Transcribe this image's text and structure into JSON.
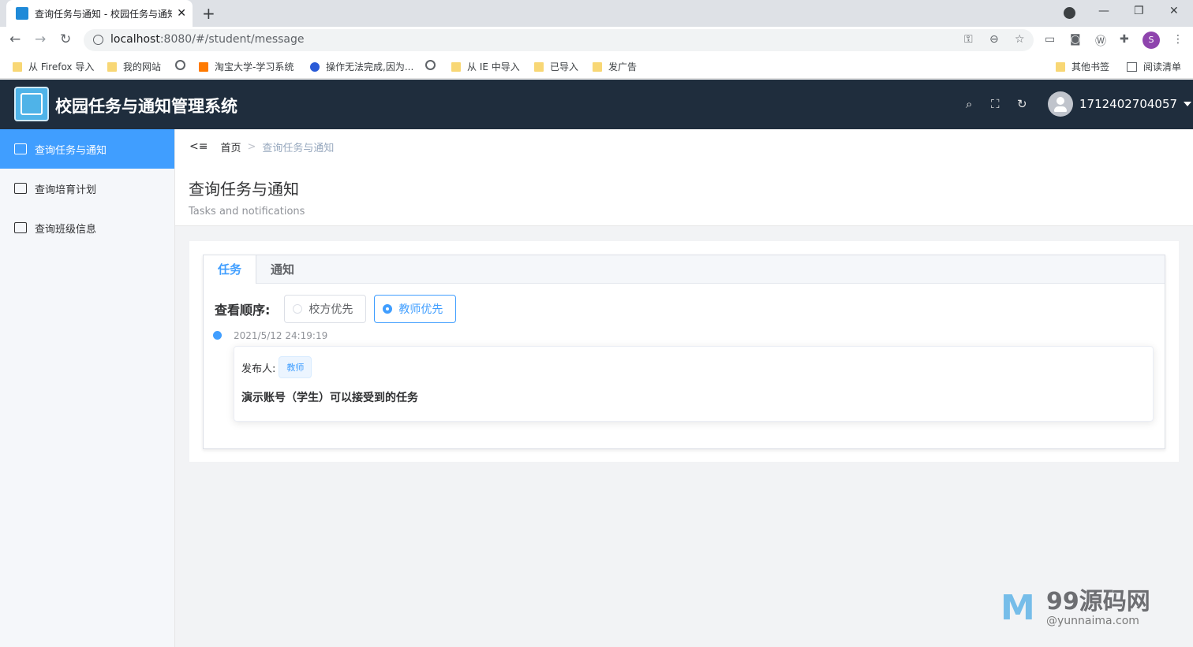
{
  "browser": {
    "tab_title": "查询任务与通知 - 校园任务与通知",
    "url_host": "localhost",
    "url_path": ":8080/#/student/message",
    "profile_initial": "S",
    "bookmarks": [
      "从 Firefox 导入",
      "我的网站",
      "淘宝大学-学习系统",
      "操作无法完成,因为...",
      "从 IE 中导入",
      "已导入",
      "发广告",
      "其他书签",
      "阅读清单"
    ]
  },
  "header": {
    "title": "校园任务与通知管理系统",
    "username": "1712402704057"
  },
  "sidebar": {
    "items": [
      {
        "label": "查询任务与通知",
        "active": true
      },
      {
        "label": "查询培育计划",
        "active": false
      },
      {
        "label": "查询班级信息",
        "active": false
      }
    ]
  },
  "breadcrumb": {
    "home": "首页",
    "current": "查询任务与通知"
  },
  "page": {
    "title": "查询任务与通知",
    "subtitle": "Tasks and notifications"
  },
  "tabs": [
    {
      "label": "任务",
      "active": true
    },
    {
      "label": "通知",
      "active": false
    }
  ],
  "order": {
    "label": "查看顺序:",
    "options": [
      {
        "label": "校方优先",
        "checked": false
      },
      {
        "label": "教师优先",
        "checked": true
      }
    ]
  },
  "timeline": {
    "timestamp": "2021/5/12 24:19:19",
    "publisher_label": "发布人:",
    "publisher_tag": "教师",
    "message": "演示账号（学生）可以接受到的任务"
  },
  "watermark": {
    "brand": "99源码网",
    "sub": "@yunnaima.com"
  },
  "colors": {
    "accent": "#409eff",
    "header_bg": "#1f2d3d"
  }
}
